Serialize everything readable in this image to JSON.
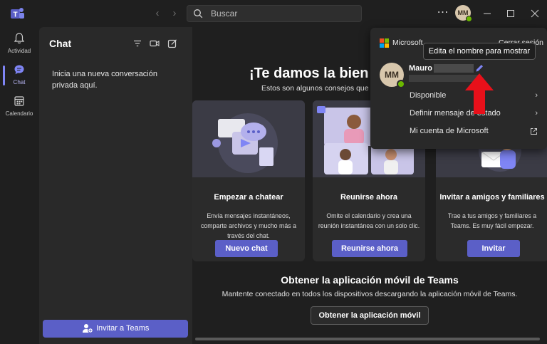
{
  "titlebar": {
    "search_placeholder": "Buscar",
    "more_icon": "more-horizontal-icon",
    "avatar_initials": "MM"
  },
  "rail": {
    "items": [
      {
        "label": "Actividad",
        "icon": "bell-icon"
      },
      {
        "label": "Chat",
        "icon": "chat-icon",
        "active": true
      },
      {
        "label": "Calendario",
        "icon": "calendar-icon"
      }
    ]
  },
  "chat_panel": {
    "title": "Chat",
    "empty_text": "Inicia una nueva conversación privada aquí.",
    "invite_button": "Invitar a Teams"
  },
  "main": {
    "welcome_title": "¡Te damos la bien",
    "welcome_subtitle": "Estos son algunos consejos que",
    "cards": [
      {
        "title": "Empezar a chatear",
        "description": "Envía mensajes instantáneos, comparte archivos y mucho más a través del chat.",
        "button": "Nuevo chat"
      },
      {
        "title": "Reunirse ahora",
        "description": "Omite el calendario y crea una reunión instantánea con un solo clic.",
        "button": "Reunirse ahora"
      },
      {
        "title": "Invitar a amigos y familiares",
        "description": "Trae a tus amigos y familiares a Teams. Es muy fácil empezar.",
        "button": "Invitar"
      }
    ],
    "mobile_title": "Obtener la aplicación móvil de Teams",
    "mobile_subtitle": "Mantente conectado en todos los dispositivos descargando la aplicación móvil de Teams.",
    "mobile_button": "Obtener la aplicación móvil"
  },
  "profile_popup": {
    "brand": "Microsoft",
    "signout": "Cerrar sesión",
    "tooltip": "Edita el nombre para mostrar",
    "avatar_initials": "MM",
    "user_name": "Mauro",
    "menu": [
      {
        "label": "Disponible"
      },
      {
        "label": "Definir mensaje de estado"
      },
      {
        "label": "Mi cuenta de Microsoft"
      }
    ]
  },
  "colors": {
    "accent": "#5b5fc7",
    "presence": "#6bb700",
    "annotation_arrow": "#e8101a"
  }
}
